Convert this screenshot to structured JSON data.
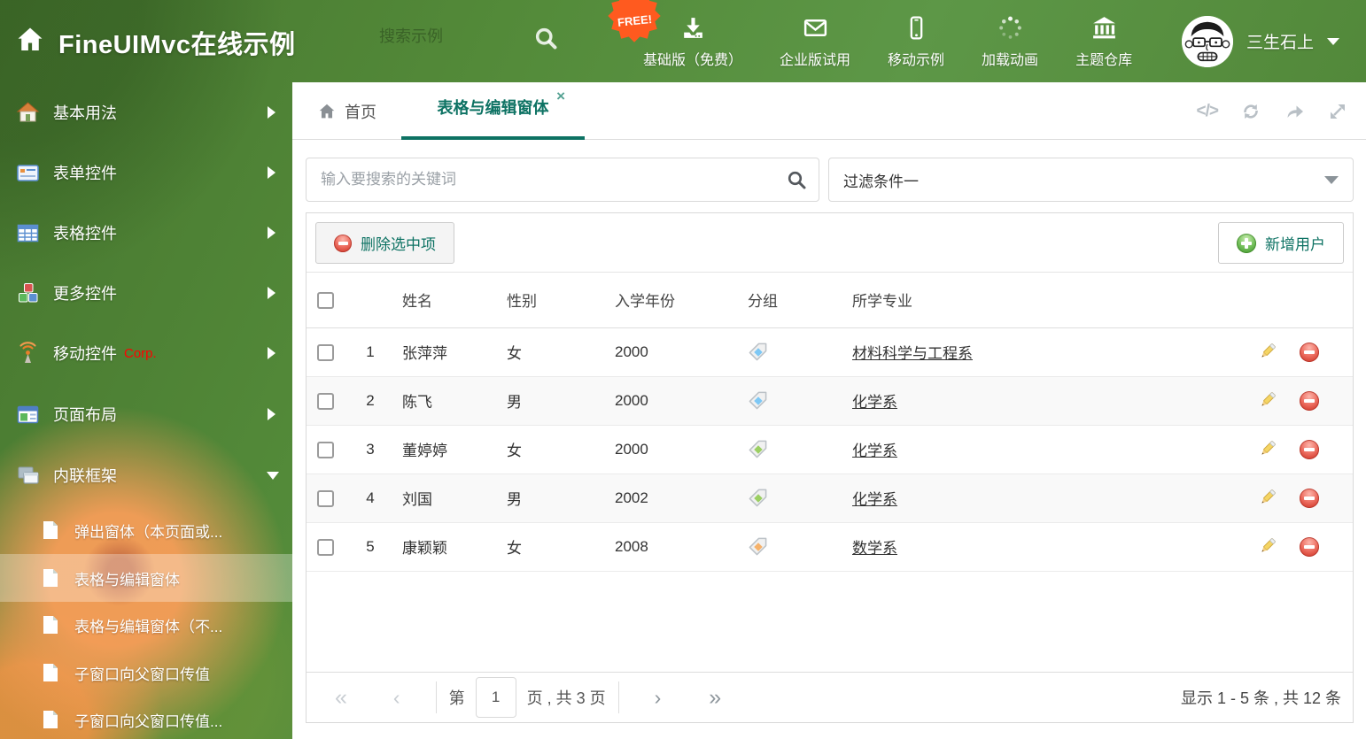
{
  "theme": {
    "accent_teal": "#0d7263",
    "header_green": "#538a39",
    "free_badge_orange": "#ff5a1f",
    "delete_red": "#da4a3c",
    "add_green": "#55a83e",
    "corp_red": "#ff0000"
  },
  "header": {
    "title": "FineUIMvc在线示例",
    "search_placeholder": "搜索示例",
    "free_badge": "FREE!",
    "nav": [
      {
        "label": "基础版（免费）",
        "icon": "download-icon"
      },
      {
        "label": "企业版试用",
        "icon": "envelope-icon"
      },
      {
        "label": "移动示例",
        "icon": "mobile-icon"
      },
      {
        "label": "加载动画",
        "icon": "spinner-icon"
      },
      {
        "label": "主题仓库",
        "icon": "bank-icon"
      }
    ],
    "user": {
      "name": "三生石上",
      "avatar": "cartoon-face-avatar"
    }
  },
  "sidebar": {
    "items": [
      {
        "label": "基本用法",
        "icon": "home-icon"
      },
      {
        "label": "表单控件",
        "icon": "form-icon"
      },
      {
        "label": "表格控件",
        "icon": "table-icon"
      },
      {
        "label": "更多控件",
        "icon": "cubes-icon"
      },
      {
        "label": "移动控件",
        "badge": "Corp.",
        "icon": "signal-icon"
      },
      {
        "label": "页面布局",
        "icon": "layout-icon"
      },
      {
        "label": "内联框架",
        "icon": "frames-icon",
        "expanded": true
      }
    ],
    "subitems": [
      {
        "label": "弹出窗体（本页面或...",
        "icon": "file-icon"
      },
      {
        "label": "表格与编辑窗体",
        "icon": "file-icon",
        "active": true
      },
      {
        "label": "表格与编辑窗体（不...",
        "icon": "file-icon"
      },
      {
        "label": "子窗口向父窗口传值",
        "icon": "file-icon"
      },
      {
        "label": "子窗口向父窗口传值...",
        "icon": "file-icon"
      }
    ]
  },
  "tabs": {
    "home": {
      "label": "首页",
      "icon": "home-icon"
    },
    "active": {
      "label": "表格与编辑窗体",
      "close_glyph": "×"
    }
  },
  "tab_tools": {
    "code_label": "</>"
  },
  "filters": {
    "search_placeholder": "输入要搜索的关键词",
    "dropdown_value": "过滤条件一"
  },
  "actions": {
    "delete_label": "删除选中项",
    "add_label": "新增用户"
  },
  "table": {
    "columns": [
      "姓名",
      "性别",
      "入学年份",
      "分组",
      "所学专业"
    ],
    "rows": [
      {
        "num": "1",
        "name": "张萍萍",
        "gender": "女",
        "year": "2000",
        "tag_color": "#7ec8f5",
        "major": "材料科学与工程系"
      },
      {
        "num": "2",
        "name": "陈飞",
        "gender": "男",
        "year": "2000",
        "tag_color": "#7ec8f5",
        "major": "化学系"
      },
      {
        "num": "3",
        "name": "董婷婷",
        "gender": "女",
        "year": "2000",
        "tag_color": "#9bcf63",
        "major": "化学系"
      },
      {
        "num": "4",
        "name": "刘国",
        "gender": "男",
        "year": "2002",
        "tag_color": "#9bcf63",
        "major": "化学系"
      },
      {
        "num": "5",
        "name": "康颖颖",
        "gender": "女",
        "year": "2008",
        "tag_color": "#f6b26b",
        "major": "数学系"
      }
    ]
  },
  "pager": {
    "first": "«",
    "prev": "‹",
    "page_prefix": "第",
    "page_value": "1",
    "page_suffix": "页 , 共 3 页",
    "next": "›",
    "last": "»",
    "summary": "显示 1 - 5 条 , 共 12 条"
  }
}
